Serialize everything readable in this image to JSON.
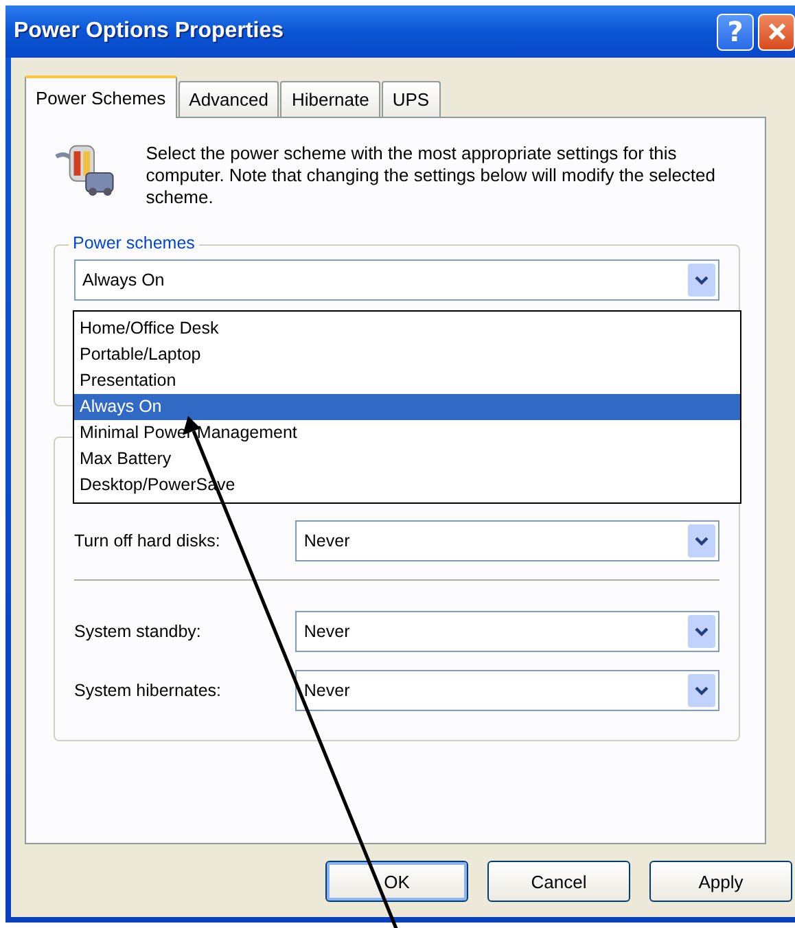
{
  "window": {
    "title": "Power Options Properties",
    "help_glyph": "?"
  },
  "tabs": [
    {
      "label": "Power Schemes",
      "selected": true
    },
    {
      "label": "Advanced",
      "selected": false
    },
    {
      "label": "Hibernate",
      "selected": false
    },
    {
      "label": "UPS",
      "selected": false
    }
  ],
  "description": "Select the power scheme with the most appropriate settings for this computer. Note that changing the settings below will modify the selected scheme.",
  "power_schemes": {
    "label": "Power schemes",
    "value": "Always On",
    "expanded": true,
    "options": [
      {
        "label": "Home/Office Desk",
        "selected": false
      },
      {
        "label": "Portable/Laptop",
        "selected": false
      },
      {
        "label": "Presentation",
        "selected": false
      },
      {
        "label": "Always On",
        "selected": true
      },
      {
        "label": "Minimal Power Management",
        "selected": false
      },
      {
        "label": "Max Battery",
        "selected": false
      },
      {
        "label": "Desktop/PowerSave",
        "selected": false
      }
    ]
  },
  "setting_groups": [
    [
      {
        "label": "Turn off hard disks:",
        "value": "Never"
      }
    ],
    [
      {
        "label": "System standby:",
        "value": "Never"
      },
      {
        "label": "System hibernates:",
        "value": "Never"
      }
    ]
  ],
  "buttons": [
    {
      "label": "OK",
      "default": true
    },
    {
      "label": "Cancel",
      "default": false
    },
    {
      "label": "Apply",
      "default": false
    }
  ]
}
